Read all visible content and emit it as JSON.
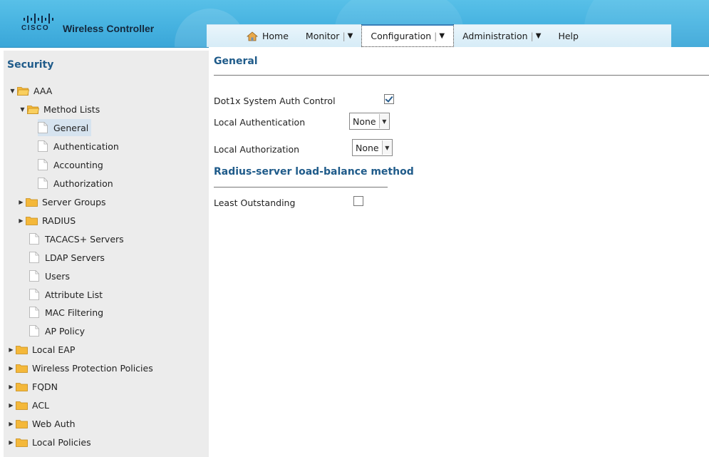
{
  "header": {
    "logo_text": "CISCO",
    "app_title": "Wireless Controller",
    "nav": [
      {
        "label": "Home",
        "icon": "home-icon"
      },
      {
        "label": "Monitor",
        "dropdown": true
      },
      {
        "label": "Configuration",
        "dropdown": true,
        "active": true
      },
      {
        "label": "Administration",
        "dropdown": true
      },
      {
        "label": "Help"
      }
    ],
    "caret": "▼",
    "sep": "|"
  },
  "sidebar": {
    "title": "Security",
    "items": [
      {
        "label": "AAA",
        "type": "folder",
        "expanded": true
      },
      {
        "label": "Method Lists",
        "type": "folder",
        "expanded": true
      },
      {
        "label": "General",
        "type": "doc",
        "selected": true
      },
      {
        "label": "Authentication",
        "type": "doc"
      },
      {
        "label": "Accounting",
        "type": "doc"
      },
      {
        "label": "Authorization",
        "type": "doc"
      },
      {
        "label": "Server Groups",
        "type": "folder",
        "expanded": false
      },
      {
        "label": "RADIUS",
        "type": "folder",
        "expanded": false
      },
      {
        "label": "TACACS+ Servers",
        "type": "doc"
      },
      {
        "label": "LDAP Servers",
        "type": "doc"
      },
      {
        "label": "Users",
        "type": "doc"
      },
      {
        "label": "Attribute List",
        "type": "doc"
      },
      {
        "label": "MAC Filtering",
        "type": "doc"
      },
      {
        "label": "AP Policy",
        "type": "doc"
      },
      {
        "label": "Local EAP",
        "type": "folder",
        "expanded": false
      },
      {
        "label": "Wireless Protection Policies",
        "type": "folder",
        "expanded": false
      },
      {
        "label": "FQDN",
        "type": "folder",
        "expanded": false
      },
      {
        "label": "ACL",
        "type": "folder",
        "expanded": false
      },
      {
        "label": "Web Auth",
        "type": "folder",
        "expanded": false
      },
      {
        "label": "Local Policies",
        "type": "folder",
        "expanded": false
      }
    ]
  },
  "main": {
    "title": "General",
    "dot1x_label": "Dot1x System Auth Control",
    "dot1x_checked": true,
    "local_authentication_label": "Local Authentication",
    "local_authentication_value": "None",
    "local_authorization_label": "Local Authorization",
    "local_authorization_value": "None",
    "radius_section_title": "Radius-server load-balance method",
    "least_outstanding_label": "Least Outstanding",
    "least_outstanding_checked": false
  },
  "colors": {
    "header_blue": "#46b2e0",
    "title_blue": "#1f5b8a",
    "sidebar_bg": "#ececec",
    "folder_yellow": "#f4b83a"
  }
}
